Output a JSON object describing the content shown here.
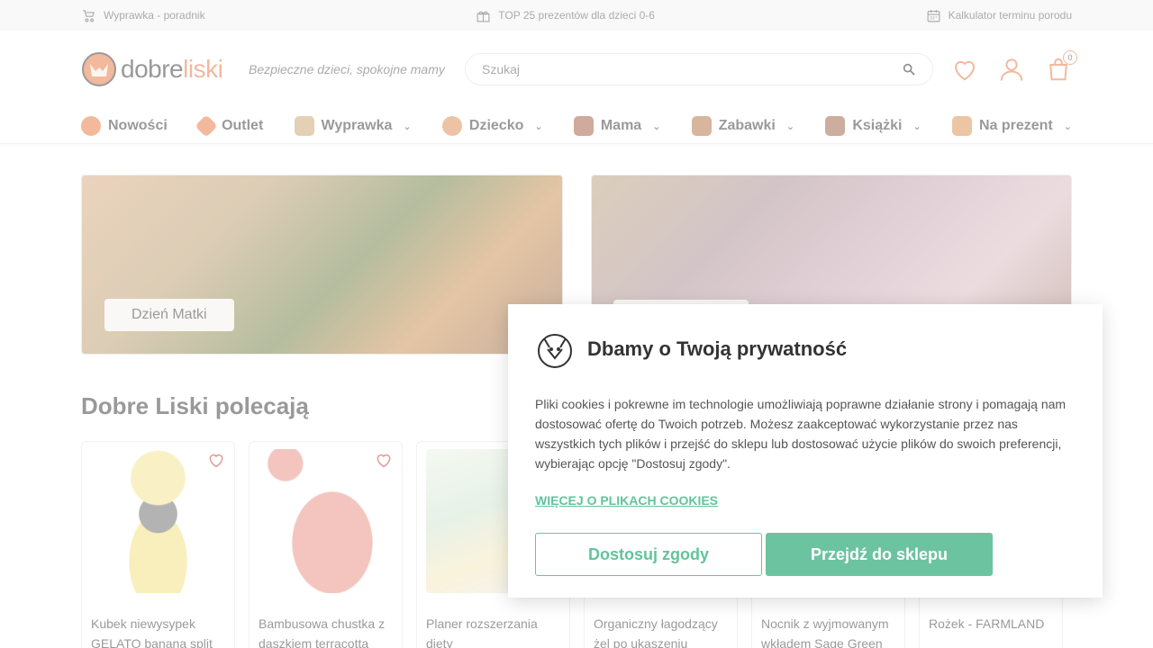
{
  "topbar": {
    "items": [
      {
        "label": "Wyprawka - poradnik",
        "icon": "stroller-icon"
      },
      {
        "label": "TOP 25 prezentów dla dzieci 0-6",
        "icon": "gift-icon"
      },
      {
        "label": "Kalkulator terminu porodu",
        "icon": "calendar-icon"
      }
    ]
  },
  "header": {
    "logo": {
      "part1": "dobre",
      "part2": "liski"
    },
    "tagline": "Bezpieczne dzieci, spokojne mamy",
    "search": {
      "placeholder": "Szukaj"
    },
    "cart_count": "0"
  },
  "nav": {
    "items": [
      {
        "label": "Nowości",
        "has_dropdown": false
      },
      {
        "label": "Outlet",
        "has_dropdown": false
      },
      {
        "label": "Wyprawka",
        "has_dropdown": true
      },
      {
        "label": "Dziecko",
        "has_dropdown": true
      },
      {
        "label": "Mama",
        "has_dropdown": true
      },
      {
        "label": "Zabawki",
        "has_dropdown": true
      },
      {
        "label": "Książki",
        "has_dropdown": true
      },
      {
        "label": "Na prezent",
        "has_dropdown": true
      }
    ]
  },
  "banners": [
    {
      "label": "Dzień Matki"
    }
  ],
  "section": {
    "title": "Dobre Liski polecają"
  },
  "products": [
    {
      "name": "Kubek niewysypek GELATO banana split"
    },
    {
      "name": "Bambusowa chustka z daszkiem terracotta"
    },
    {
      "name": "Planer rozszerzania diety"
    },
    {
      "name": "Organiczny łagodzący żel po ukąszeniu"
    },
    {
      "name": "Nocnik z wyjmowanym wkładem Sage Green"
    },
    {
      "name": "Rożek - FARMLAND"
    }
  ],
  "cookie": {
    "title": "Dbamy o Twoją prywatność",
    "body": "Pliki cookies i pokrewne im technologie umożliwiają poprawne działanie strony i pomagają nam dostosować ofertę do Twoich potrzeb. Możesz zaakceptować wykorzystanie przez nas wszystkich tych plików i przejść do sklepu lub dostosować użycie plików do swoich preferencji, wybierając opcję \"Dostosuj zgody\".",
    "link": "WIĘCEJ O PLIKACH COOKIES",
    "customize_label": "Dostosuj zgody",
    "accept_label": "Przejdź do sklepu"
  },
  "colors": {
    "brand_orange": "#e5733a",
    "accent_green": "#6cc3a0",
    "heart_red": "#c0392b"
  }
}
